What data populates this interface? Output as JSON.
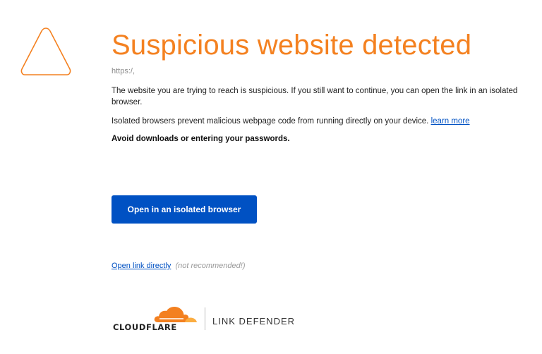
{
  "header": {
    "title": "Suspicious website detected",
    "url": "https:/,"
  },
  "body": {
    "paragraph_1": "The website you are trying to reach is suspicious. If you still want to continue, you can open the link in an isolated browser.",
    "paragraph_2": "Isolated browsers prevent malicious webpage code from running directly on your device.",
    "learn_more": "learn more",
    "warning": "Avoid downloads or entering your passwords."
  },
  "actions": {
    "isolated_button": "Open in an isolated browser",
    "direct_link": "Open link directly",
    "direct_note": "(not recommended!)"
  },
  "footer": {
    "brand": "CLOUDFLARE",
    "product": "LINK DEFENDER"
  },
  "colors": {
    "accent": "#f48120",
    "primary": "#0051c3"
  },
  "icons": {
    "warning": "warning-triangle-icon",
    "logo": "cloudflare-cloud-icon"
  }
}
